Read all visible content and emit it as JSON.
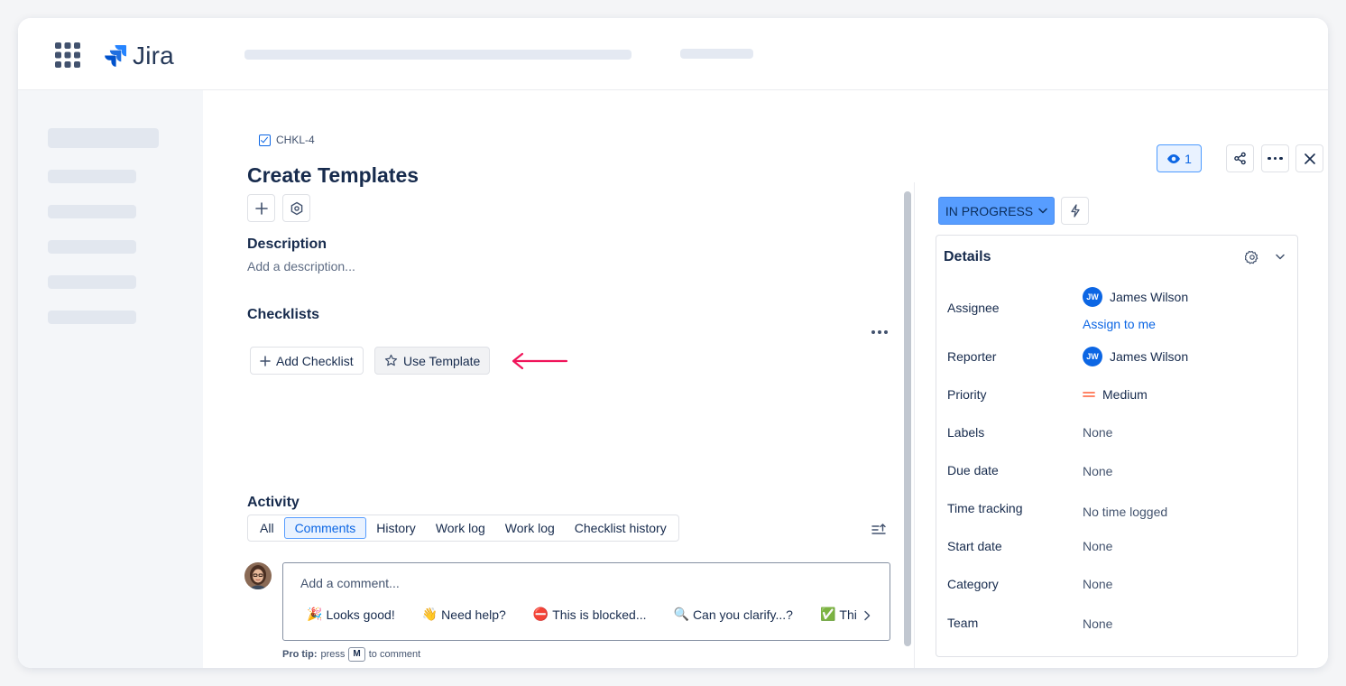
{
  "app": {
    "name": "Jira"
  },
  "issue": {
    "key": "CHKL-4",
    "title": "Create Templates"
  },
  "description": {
    "heading": "Description",
    "placeholder": "Add a description..."
  },
  "checklists": {
    "heading": "Checklists",
    "add_label": "Add Checklist",
    "template_label": "Use Template"
  },
  "activity": {
    "heading": "Activity",
    "tabs": [
      "All",
      "Comments",
      "History",
      "Work log",
      "Work log",
      "Checklist history"
    ],
    "active_tab": "Comments",
    "comment_placeholder": "Add a comment...",
    "quick_replies": [
      {
        "emoji": "🎉",
        "text": "Looks good!"
      },
      {
        "emoji": "👋",
        "text": "Need help?"
      },
      {
        "emoji": "⛔",
        "text": "This is blocked..."
      },
      {
        "emoji": "🔍",
        "text": "Can you clarify...?"
      },
      {
        "emoji": "✅",
        "text": "Thi"
      }
    ],
    "protip_label": "Pro tip:",
    "protip_press": "press",
    "protip_key": "M",
    "protip_suffix": "to comment"
  },
  "toolbar": {
    "watchers_count": "1"
  },
  "status": {
    "label": "IN PROGRESS"
  },
  "details": {
    "heading": "Details",
    "assignee": {
      "label": "Assignee",
      "initials": "JW",
      "name": "James Wilson",
      "assign_to_me": "Assign to me"
    },
    "reporter": {
      "label": "Reporter",
      "initials": "JW",
      "name": "James Wilson"
    },
    "priority": {
      "label": "Priority",
      "value": "Medium"
    },
    "labels": {
      "label": "Labels",
      "value": "None"
    },
    "due_date": {
      "label": "Due date",
      "value": "None"
    },
    "time_tracking": {
      "label": "Time tracking",
      "value": "No time logged"
    },
    "start_date": {
      "label": "Start date",
      "value": "None"
    },
    "category": {
      "label": "Category",
      "value": "None"
    },
    "team": {
      "label": "Team",
      "value": "None"
    }
  },
  "colors": {
    "brand": "#2684ff",
    "link": "#0c66e4",
    "status_bg": "#579dff",
    "annotation_arrow": "#f0145a",
    "priority_medium": "#ff7452"
  }
}
